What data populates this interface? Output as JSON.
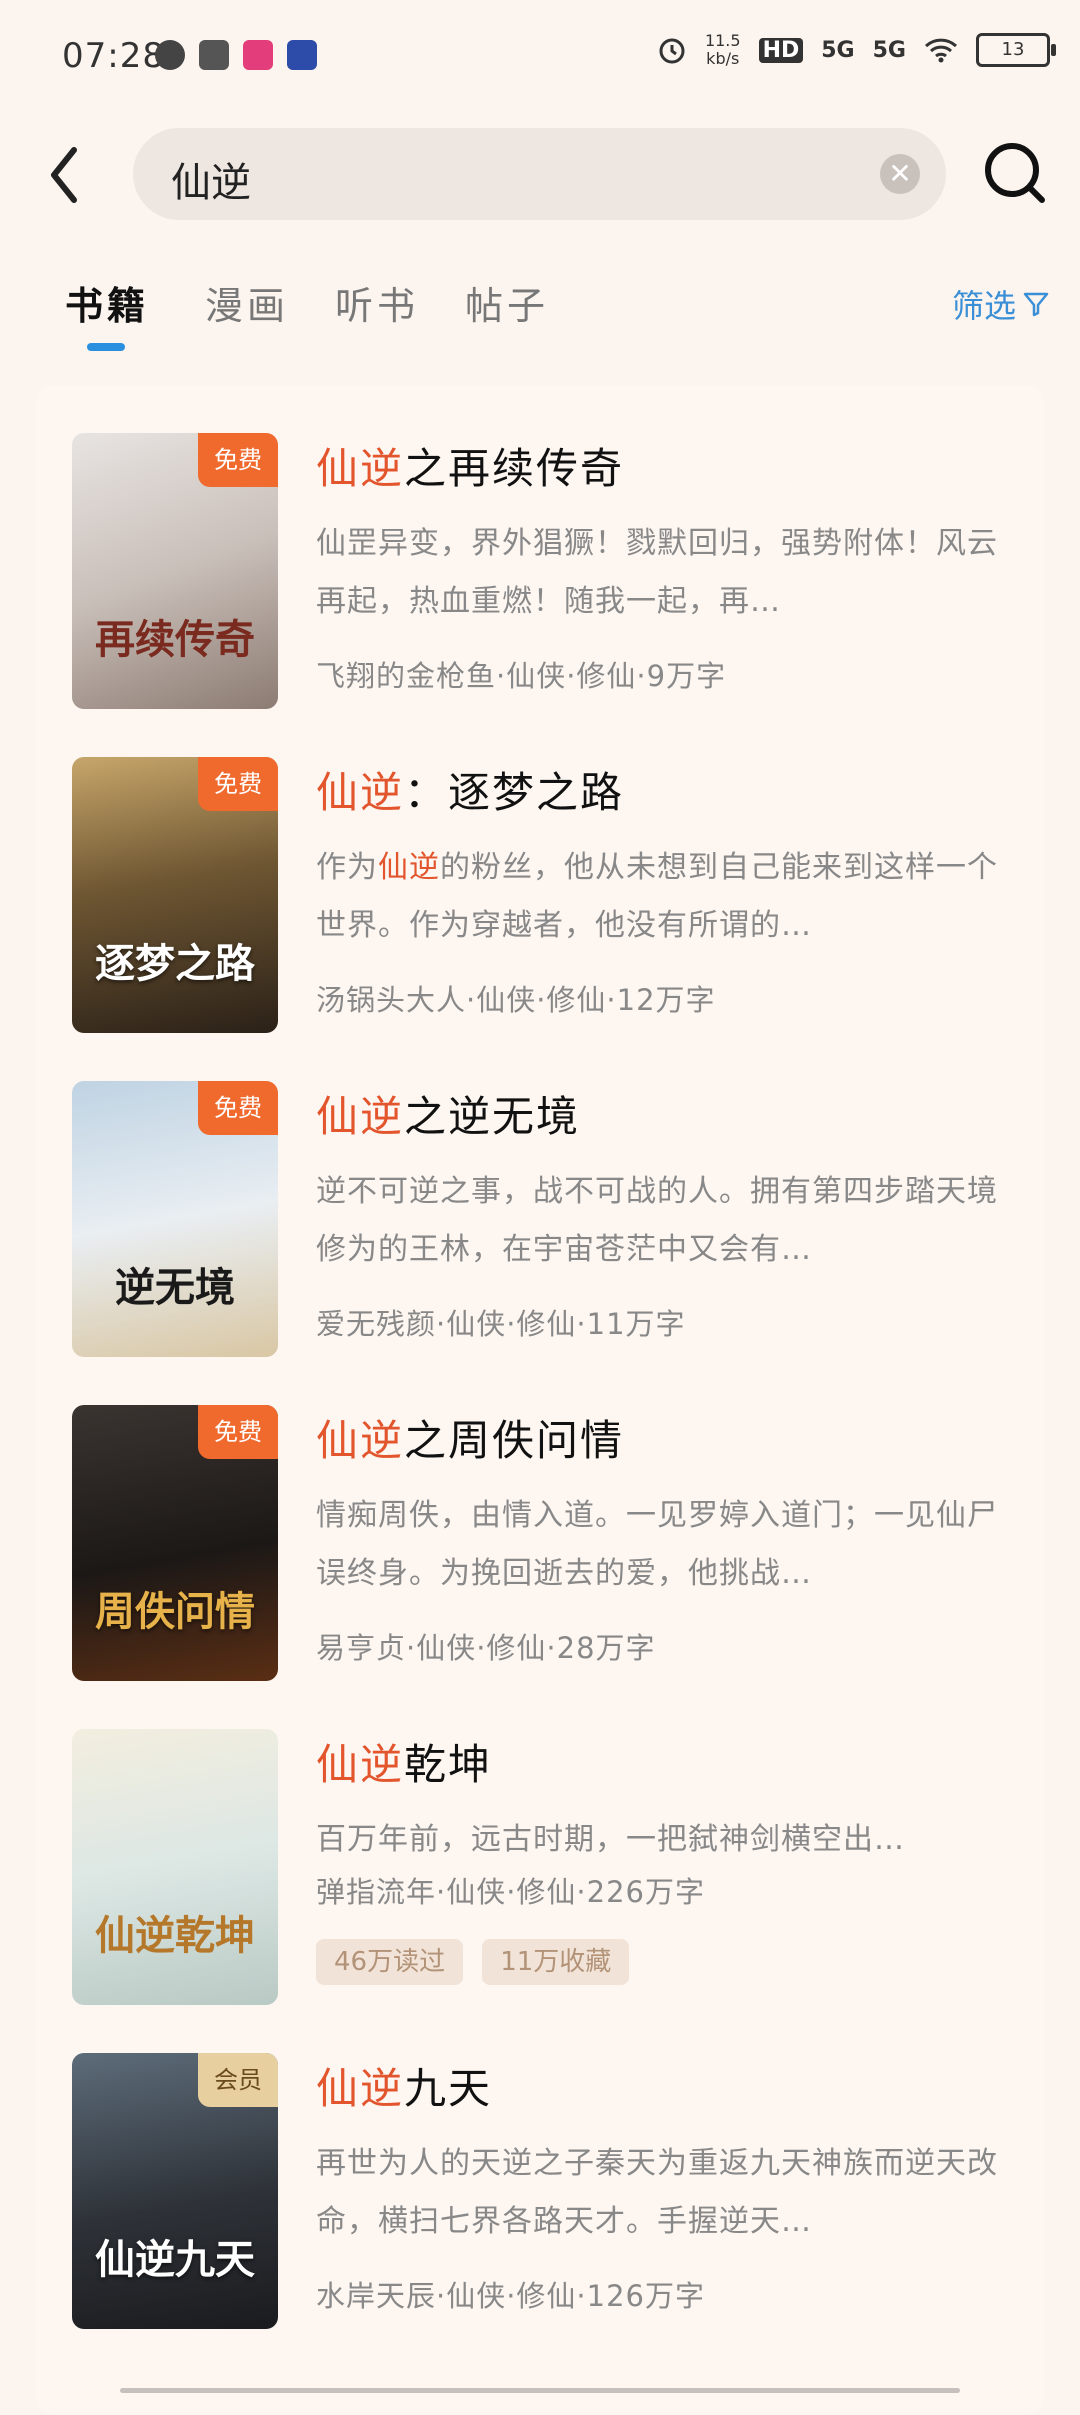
{
  "status_bar": {
    "time": "07:28",
    "speed_value": "11.5",
    "speed_unit": "kb/s",
    "hd": "HD",
    "net1": "5G",
    "net2": "5G",
    "battery": "13"
  },
  "search": {
    "back_icon": "chevron-left-icon",
    "query": "仙逆",
    "clear_icon": "clear-circle-icon",
    "search_icon": "search-icon"
  },
  "tabs": [
    {
      "label": "书籍",
      "active": true
    },
    {
      "label": "漫画",
      "active": false
    },
    {
      "label": "听书",
      "active": false
    },
    {
      "label": "帖子",
      "active": false
    }
  ],
  "filter_label": "筛选",
  "books": [
    {
      "title_hl": "仙逆",
      "title_rest": "之再续传奇",
      "desc": "仙罡异变，界外猖獗！戮默回归，强势附体！风云再起，热血重燃！随我一起，再…",
      "meta": "飞翔的金枪鱼·仙侠·修仙·9万字",
      "tag": "免费",
      "cover_text": "再续传奇"
    },
    {
      "title_hl": "仙逆",
      "title_rest": "：逐梦之路",
      "desc_pre": "作为",
      "desc_hl": "仙逆",
      "desc_post": "的粉丝，他从未想到自己能来到这样一个世界。作为穿越者，他没有所谓的…",
      "meta": "汤锅头大人·仙侠·修仙·12万字",
      "tag": "免费",
      "cover_text": "逐梦之路"
    },
    {
      "title_hl": "仙逆",
      "title_rest": "之逆无境",
      "desc": "逆不可逆之事，战不可战的人。拥有第四步踏天境修为的王林，在宇宙苍茫中又会有…",
      "meta": "爱无残颜·仙侠·修仙·11万字",
      "tag": "免费",
      "cover_text": "逆无境"
    },
    {
      "title_hl": "仙逆",
      "title_rest": "之周佚问情",
      "desc": "情痴周佚，由情入道。一见罗婷入道门；一见仙尸误终身。为挽回逝去的爱，他挑战…",
      "meta": "易亨贞·仙侠·修仙·28万字",
      "tag": "免费",
      "cover_text": "周佚问情"
    },
    {
      "title_hl": "仙逆",
      "title_rest": "乾坤",
      "desc": "百万年前，远古时期，一把弑神剑横空出…",
      "meta": "弹指流年·仙侠·修仙·226万字",
      "badges": [
        "46万读过",
        "11万收藏"
      ],
      "cover_text": "仙逆乾坤"
    },
    {
      "title_hl": "仙逆",
      "title_rest": "九天",
      "desc": "再世为人的天逆之子秦天为重返九天神族而逆天改命，横扫七界各路天才。手握逆天…",
      "meta": "水岸天辰·仙侠·修仙·126万字",
      "tag": "会员",
      "cover_text": "仙逆九天"
    }
  ],
  "colors": {
    "highlight": "#E2552D",
    "tab_indicator": "#2B8FE0",
    "filter": "#3A8FD6",
    "free_tag": "#F06A2E",
    "vip_tag": "#E8CFA0"
  }
}
